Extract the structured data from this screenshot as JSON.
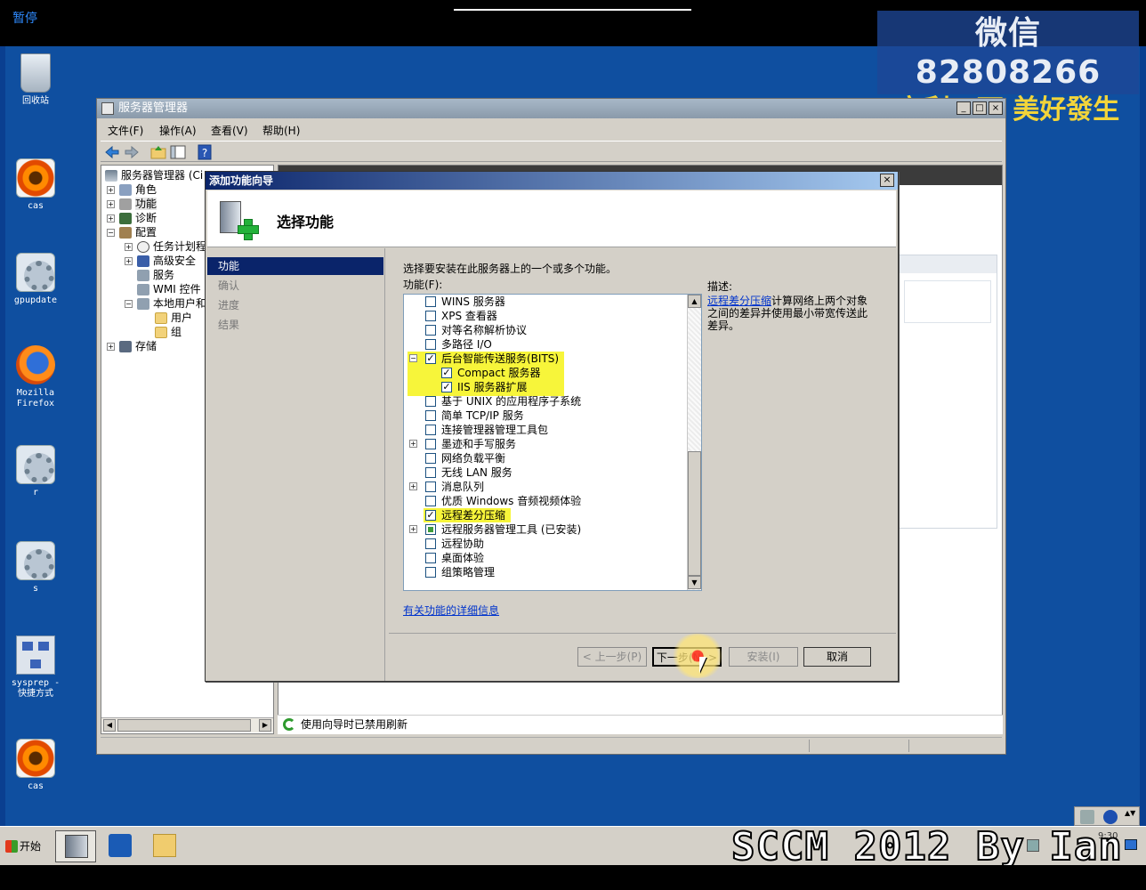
{
  "player": {
    "pause_label": "暂停"
  },
  "watermark": {
    "line1": "微信 82808266",
    "line2": "安利一下 美好發生"
  },
  "overlay": {
    "text": "SCCM 2012 By Ian"
  },
  "desktop_icons": [
    {
      "label": "回收站",
      "icon": "recycle-bin-icon"
    },
    {
      "label": "cas",
      "icon": "flower-icon"
    },
    {
      "label": "gpupdate",
      "icon": "gear-icon"
    },
    {
      "label": "Mozilla Firefox",
      "icon": "firefox-icon"
    },
    {
      "label": "r",
      "icon": "gear-icon"
    },
    {
      "label": "s",
      "icon": "gear-icon"
    },
    {
      "label": "sysprep - 快捷方式",
      "icon": "network-shortcut-icon"
    },
    {
      "label": "cas",
      "icon": "flower-icon"
    }
  ],
  "server_manager": {
    "title": "服务器管理器",
    "menu": [
      "文件(F)",
      "操作(A)",
      "查看(V)",
      "帮助(H)"
    ],
    "tree": [
      {
        "label": "服务器管理器 (Ci",
        "level": 0
      },
      {
        "label": "角色",
        "level": 1,
        "expander": "+"
      },
      {
        "label": "功能",
        "level": 1,
        "expander": "+"
      },
      {
        "label": "诊断",
        "level": 1,
        "expander": "+"
      },
      {
        "label": "配置",
        "level": 1,
        "expander": "-"
      },
      {
        "label": "任务计划程",
        "level": 2,
        "expander": "+"
      },
      {
        "label": "高级安全",
        "level": 2,
        "expander": "+"
      },
      {
        "label": "服务",
        "level": 2
      },
      {
        "label": "WMI 控件",
        "level": 2
      },
      {
        "label": "本地用户和",
        "level": 2,
        "expander": "-"
      },
      {
        "label": "用户",
        "level": 3
      },
      {
        "label": "组",
        "level": 3
      },
      {
        "label": "存储",
        "level": 1,
        "expander": "+"
      }
    ],
    "status_text": "使用向导时已禁用刷新"
  },
  "wizard": {
    "title": "添加功能向导",
    "header_title": "选择功能",
    "nav": [
      {
        "label": "功能",
        "active": true
      },
      {
        "label": "确认",
        "active": false
      },
      {
        "label": "进度",
        "active": false
      },
      {
        "label": "结果",
        "active": false
      }
    ],
    "instruction": "选择要安装在此服务器上的一个或多个功能。",
    "features_label": "功能(F):",
    "features": [
      {
        "label": "WINS 服务器",
        "checked": false,
        "indent": 0
      },
      {
        "label": "XPS 查看器",
        "checked": false,
        "indent": 0
      },
      {
        "label": "对等名称解析协议",
        "checked": false,
        "indent": 0
      },
      {
        "label": "多路径 I/O",
        "checked": false,
        "indent": 0
      },
      {
        "label": "后台智能传送服务(BITS)",
        "checked": true,
        "indent": 0,
        "expander": "-",
        "highlight": true
      },
      {
        "label": "Compact 服务器",
        "checked": true,
        "indent": 1,
        "highlight": true
      },
      {
        "label": "IIS 服务器扩展",
        "checked": true,
        "indent": 1,
        "highlight": true
      },
      {
        "label": "基于 UNIX 的应用程序子系统",
        "checked": false,
        "indent": 0
      },
      {
        "label": "简单 TCP/IP 服务",
        "checked": false,
        "indent": 0
      },
      {
        "label": "连接管理器管理工具包",
        "checked": false,
        "indent": 0
      },
      {
        "label": "墨迹和手写服务",
        "checked": false,
        "indent": 0,
        "expander": "+"
      },
      {
        "label": "网络负载平衡",
        "checked": false,
        "indent": 0
      },
      {
        "label": "无线 LAN 服务",
        "checked": false,
        "indent": 0
      },
      {
        "label": "消息队列",
        "checked": false,
        "indent": 0,
        "expander": "+"
      },
      {
        "label": "优质 Windows 音频视频体验",
        "checked": false,
        "indent": 0
      },
      {
        "label": "远程差分压缩",
        "checked": true,
        "indent": 0,
        "highlight": true
      },
      {
        "label": "远程服务器管理工具  (已安装)",
        "checked": "partial",
        "indent": 0,
        "expander": "+"
      },
      {
        "label": "远程协助",
        "checked": false,
        "indent": 0
      },
      {
        "label": "桌面体验",
        "checked": false,
        "indent": 0
      },
      {
        "label": "组策略管理",
        "checked": false,
        "indent": 0
      }
    ],
    "more_info_link": "有关功能的详细信息",
    "description_label": "描述:",
    "description_link": "远程差分压缩",
    "description_text": "计算网络上两个对象之间的差异并使用最小带宽传送此差异。",
    "buttons": {
      "prev": "< 上一步(P)",
      "next": "下一步(N) >",
      "install": "安装(I)",
      "cancel": "取消"
    }
  },
  "taskbar": {
    "start_label": "开始",
    "clock": "9:30"
  }
}
